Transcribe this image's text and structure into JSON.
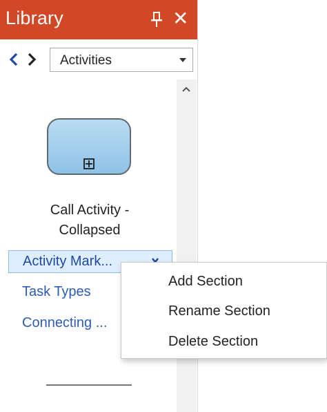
{
  "panel": {
    "title": "Library",
    "title_bar_color": "#d24726",
    "pin_icon": "pin-icon",
    "close_glyph": "✕"
  },
  "nav": {
    "back_icon": "chevron-left-icon",
    "forward_icon": "chevron-right-icon",
    "selected_category": "Activities"
  },
  "shape": {
    "label_line1": "Call Activity -",
    "label_line2": "Collapsed",
    "fill_color": "#9fcbea",
    "marker_icon": "subprocess-plus-icon"
  },
  "sections": [
    {
      "label": "Activity Mark...",
      "active": true
    },
    {
      "label": "Task Types"
    },
    {
      "label": "Connecting ..."
    }
  ],
  "context_menu": {
    "items": [
      "Add Section",
      "Rename Section",
      "Delete Section"
    ]
  }
}
